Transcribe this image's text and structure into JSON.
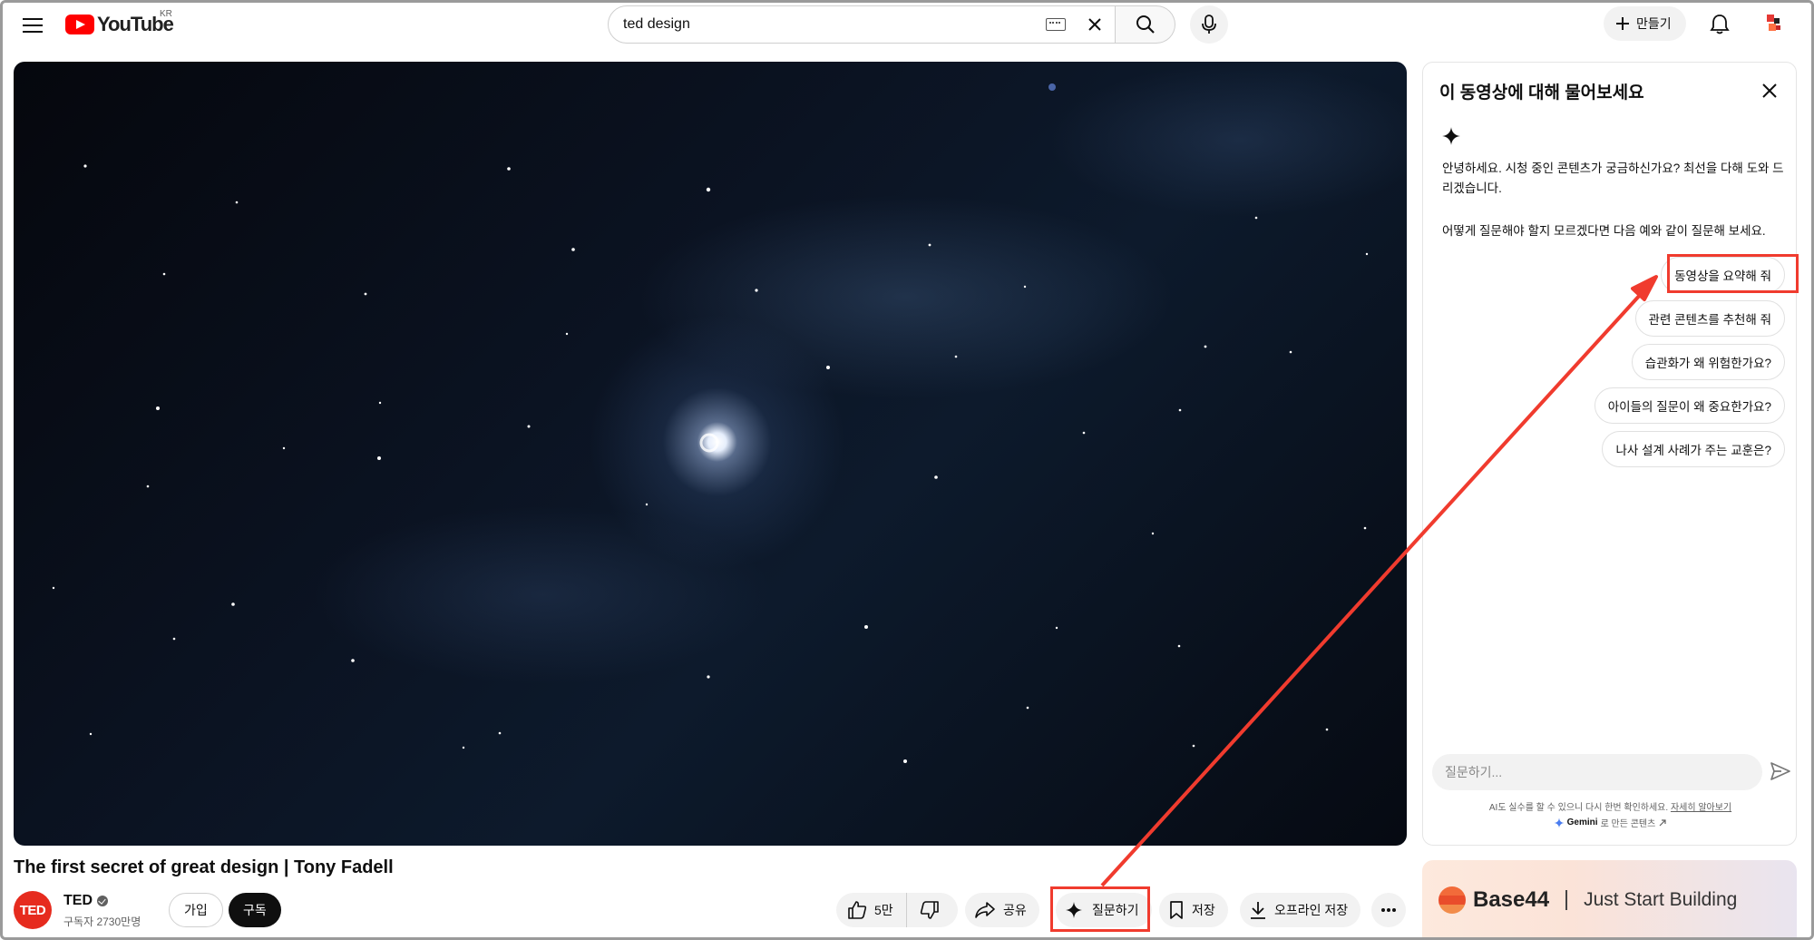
{
  "header": {
    "logo_text": "YouTube",
    "region": "KR",
    "search_value": "ted design",
    "create_label": "만들기"
  },
  "video": {
    "title": "The first secret of great design | Tony Fadell",
    "channel": "TED",
    "channel_logo": "TED",
    "subscribers": "구독자 2730만명",
    "join_label": "가입",
    "subscribe_label": "구독",
    "actions": {
      "like_count": "5만",
      "share_label": "공유",
      "ask_label": "질문하기",
      "save_label": "저장",
      "offline_label": "오프라인 저장"
    }
  },
  "ask_panel": {
    "title": "이 동영상에 대해 물어보세요",
    "greeting": "안녕하세요. 시청 중인 콘텐츠가 궁금하신가요? 최선을 다해 도와 드리겠습니다.",
    "hint": "어떻게 질문해야 할지 모르겠다면 다음 예와 같이 질문해 보세요.",
    "suggestions": [
      "동영상을 요약해 줘",
      "관련 콘텐츠를 추천해 줘",
      "습관화가 왜 위험한가요?",
      "아이들의 질문이 왜 중요한가요?",
      "나사 설계 사례가 주는 교훈은?"
    ],
    "input_placeholder": "질문하기...",
    "disclaimer": "AI도 실수를 할 수 있으니 다시 한번 확인하세요.",
    "learn_more": "자세히 알아보기",
    "gemini_brand": "Gemini",
    "gemini_suffix": "로 만든 콘텐츠"
  },
  "ad": {
    "brand": "Base44",
    "tagline": "Just Start Building"
  },
  "colors": {
    "annotation_red": "#f03b2e",
    "youtube_red": "#ff0000",
    "ted_red": "#e62b1e"
  }
}
